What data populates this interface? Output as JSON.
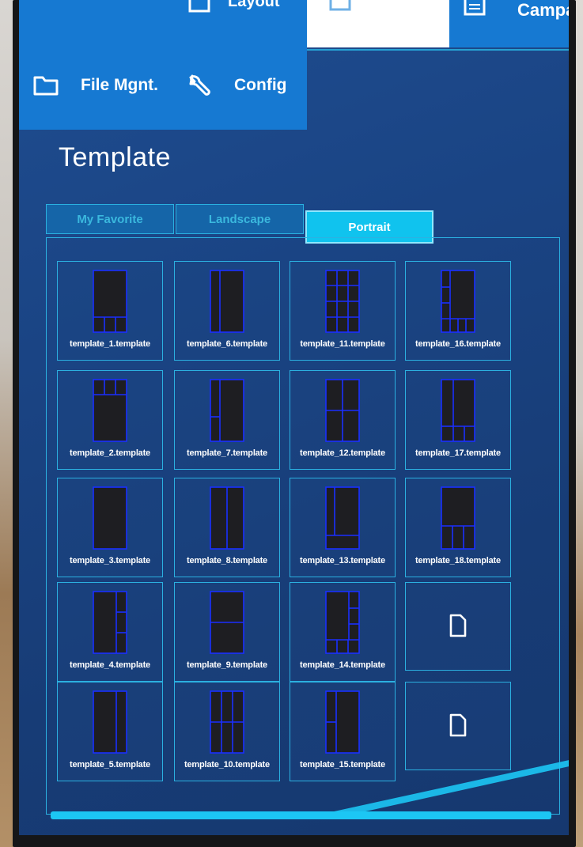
{
  "nav": {
    "top_items": [
      {
        "label": "",
        "icon": "folder-icon"
      },
      {
        "label": "Layout",
        "icon": "layout-icon"
      },
      {
        "label": "",
        "icon": "blank"
      },
      {
        "label": "Campaign",
        "icon": "campaign-icon"
      }
    ],
    "file_mgnt": {
      "label": "File Mgnt.",
      "icon": "folder-icon"
    },
    "config": {
      "label": "Config",
      "icon": "wrench-icon"
    }
  },
  "page": {
    "title": "Template"
  },
  "tabs": [
    {
      "label": "My Favorite",
      "active": false
    },
    {
      "label": "Landscape",
      "active": false
    },
    {
      "label": "Portrait",
      "active": true
    }
  ],
  "templates": [
    {
      "label": "template_1.template",
      "layout": "big-top-3-bottom"
    },
    {
      "label": "template_6.template",
      "layout": "narrow-left-wide-right"
    },
    {
      "label": "template_11.template",
      "layout": "grid-3x4"
    },
    {
      "label": "template_16.template",
      "layout": "side-strip-bottom-row"
    },
    {
      "label": "template_2.template",
      "layout": "3-top-big-bottom"
    },
    {
      "label": "template_7.template",
      "layout": "narrow-left-split"
    },
    {
      "label": "template_12.template",
      "layout": "grid-2x2"
    },
    {
      "label": "template_17.template",
      "layout": "left-column-right-split"
    },
    {
      "label": "template_3.template",
      "layout": "single"
    },
    {
      "label": "template_8.template",
      "layout": "two-columns"
    },
    {
      "label": "template_13.template",
      "layout": "left-col-bottom-bar"
    },
    {
      "label": "template_18.template",
      "layout": "top-big-3-bottom-right"
    },
    {
      "label": "template_4.template",
      "layout": "wide-left-right-3"
    },
    {
      "label": "template_9.template",
      "layout": "two-rows"
    },
    {
      "label": "template_14.template",
      "layout": "right-strip-bottom-row"
    },
    {
      "label": "",
      "layout": "new-file"
    },
    {
      "label": "template_5.template",
      "layout": "narrow-right"
    },
    {
      "label": "template_10.template",
      "layout": "grid-3x3"
    },
    {
      "label": "template_15.template",
      "layout": "left-2-right-big"
    },
    {
      "label": "",
      "layout": "new-file"
    }
  ],
  "colors": {
    "accent": "#1cc6f4",
    "thumb_border": "#1a2fff",
    "thumb_fill": "#1e1e22"
  }
}
